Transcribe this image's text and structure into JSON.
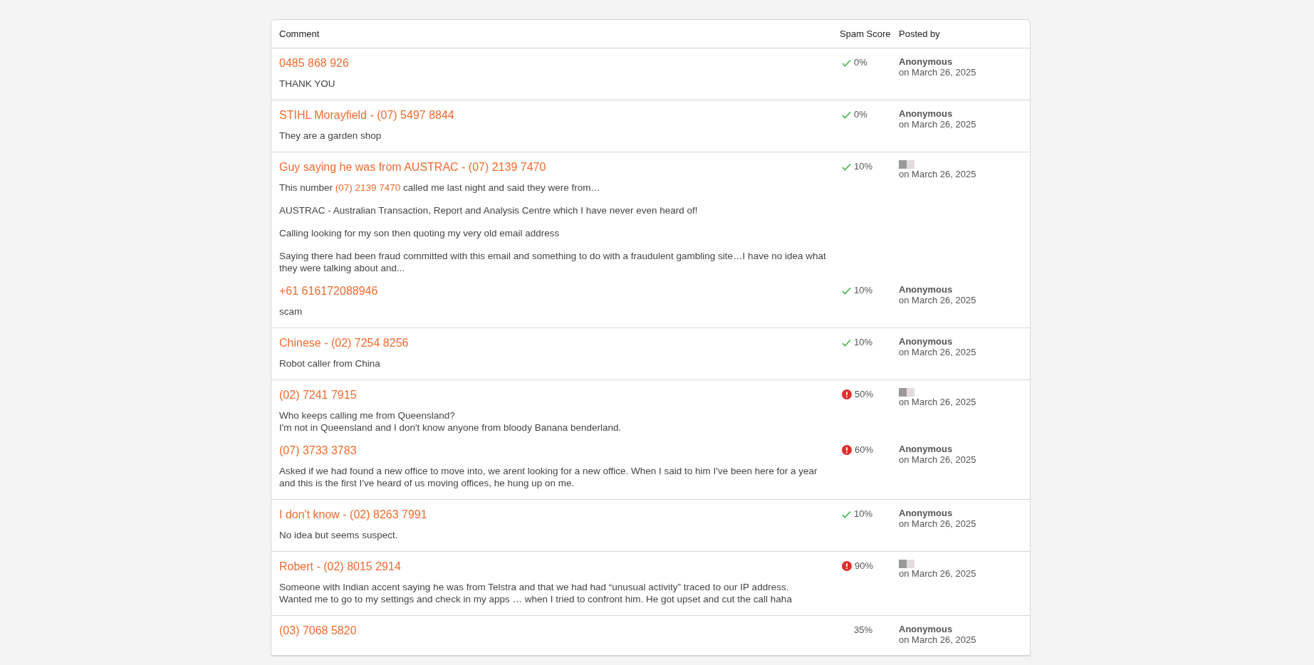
{
  "table": {
    "columns": [
      "Comment",
      "Spam Score",
      "Posted by"
    ],
    "groups": [
      {
        "comments": [
          {
            "title": "0485 868 926",
            "paragraphs": [
              [
                {
                  "kind": "text",
                  "text": "THANK YOU"
                }
              ]
            ],
            "score": {
              "kind": "ok",
              "text": "0%"
            },
            "poster": {
              "kind": "name",
              "name": "Anonymous"
            },
            "date": "on March 26, 2025"
          }
        ]
      },
      {
        "comments": [
          {
            "title": "STIHL Morayfield - (07) 5497 8844",
            "paragraphs": [
              [
                {
                  "kind": "text",
                  "text": "They are a garden shop"
                }
              ]
            ],
            "score": {
              "kind": "ok",
              "text": "0%"
            },
            "poster": {
              "kind": "name",
              "name": "Anonymous"
            },
            "date": "on March 26, 2025"
          }
        ]
      },
      {
        "comments": [
          {
            "title": "Guy saying he was from AUSTRAC - (07) 2139 7470",
            "paragraphs": [
              [
                {
                  "kind": "text",
                  "text": "This number "
                },
                {
                  "kind": "link",
                  "text": "(07) 2139 7470"
                },
                {
                  "kind": "text",
                  "text": " called me last night and said they were from…"
                }
              ],
              [
                {
                  "kind": "text",
                  "text": "AUSTRAC - Australian Transaction, Report and Analysis Centre which I have never even heard of!"
                }
              ],
              [
                {
                  "kind": "text",
                  "text": "Calling looking for my son then quoting my very old email address"
                }
              ],
              [
                {
                  "kind": "text",
                  "text": "Saying there had been fraud committed with this email and something to do with a fraudulent gambling site…I have no idea what they were talking about and..."
                }
              ]
            ],
            "score": {
              "kind": "ok",
              "text": "10%"
            },
            "poster": {
              "kind": "redacted"
            },
            "date": "on March 26, 2025"
          },
          {
            "title": "+61 616172088946",
            "paragraphs": [
              [
                {
                  "kind": "text",
                  "text": "scam"
                }
              ]
            ],
            "score": {
              "kind": "ok",
              "text": "10%"
            },
            "poster": {
              "kind": "name",
              "name": "Anonymous"
            },
            "date": "on March 26, 2025"
          }
        ]
      },
      {
        "comments": [
          {
            "title": "Chinese - (02) 7254 8256",
            "paragraphs": [
              [
                {
                  "kind": "text",
                  "text": "Robot caller from China"
                }
              ]
            ],
            "score": {
              "kind": "ok",
              "text": "10%"
            },
            "poster": {
              "kind": "name",
              "name": "Anonymous"
            },
            "date": "on March 26, 2025"
          }
        ]
      },
      {
        "comments": [
          {
            "title": "(02) 7241 7915",
            "paragraphs": [
              [
                {
                  "kind": "text",
                  "text": "Who keeps calling me from Queensland?\nI'm not in Queensland and I don't know anyone from bloody Banana benderland."
                }
              ]
            ],
            "score": {
              "kind": "warn",
              "text": "50%"
            },
            "poster": {
              "kind": "redacted"
            },
            "date": "on March 26, 2025"
          },
          {
            "title": "(07) 3733 3783",
            "paragraphs": [
              [
                {
                  "kind": "text",
                  "text": "Asked if we had found a new office to move into, we arent looking for a new office. When I said to him I've been here for a year and this is the first I've heard of us moving offices, he hung up on me."
                }
              ]
            ],
            "score": {
              "kind": "warn",
              "text": "60%"
            },
            "poster": {
              "kind": "name",
              "name": "Anonymous"
            },
            "date": "on March 26, 2025"
          }
        ]
      },
      {
        "comments": [
          {
            "title": "I don't know - (02) 8263 7991",
            "paragraphs": [
              [
                {
                  "kind": "text",
                  "text": "No idea but seems suspect."
                }
              ]
            ],
            "score": {
              "kind": "ok",
              "text": "10%"
            },
            "poster": {
              "kind": "name",
              "name": "Anonymous"
            },
            "date": "on March 26, 2025"
          }
        ]
      },
      {
        "comments": [
          {
            "title": "Robert - (02) 8015 2914",
            "paragraphs": [
              [
                {
                  "kind": "text",
                  "text": "Someone with Indian accent saying he was from Telstra and that we had had “unusual activity” traced to our IP address.\nWanted me to go to my settings and check in my apps … when I tried to confront him. He got upset and cut the call haha"
                }
              ]
            ],
            "score": {
              "kind": "warn",
              "text": "90%"
            },
            "poster": {
              "kind": "redacted"
            },
            "date": "on March 26, 2025"
          }
        ]
      },
      {
        "comments": [
          {
            "title": "(03) 7068 5820",
            "score": {
              "text": "35%"
            },
            "poster": {
              "kind": "name",
              "name": "Anonymous"
            },
            "date": "on March 26, 2025"
          }
        ]
      }
    ]
  }
}
